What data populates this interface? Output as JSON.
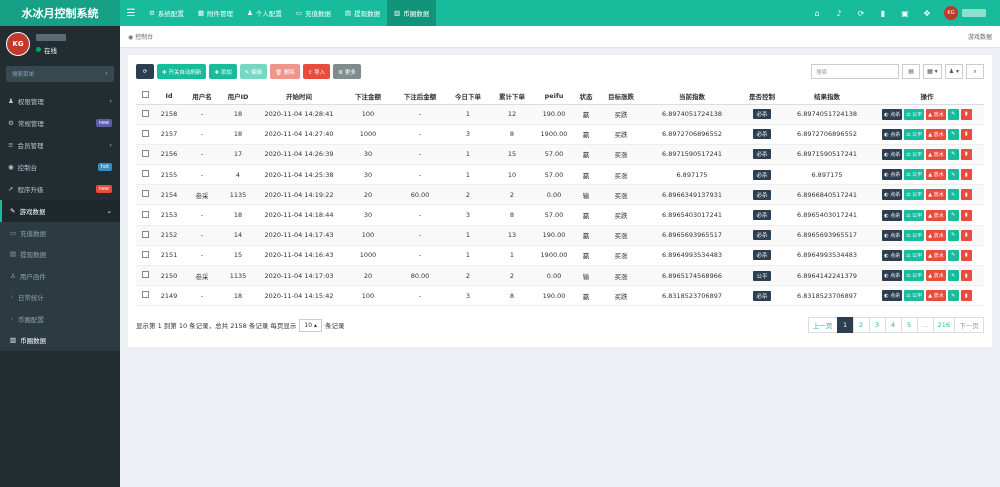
{
  "app": {
    "title": "水冰月控制系统"
  },
  "topnav": {
    "items": [
      {
        "icon": "gear-icon",
        "glyph": "⚙",
        "label": "系统配置"
      },
      {
        "icon": "paperclip-icon",
        "glyph": "▦",
        "label": "附件管理"
      },
      {
        "icon": "user-icon",
        "glyph": "♟",
        "label": "个人配置"
      },
      {
        "icon": "card-icon",
        "glyph": "▭",
        "label": "充值数据"
      },
      {
        "icon": "list-icon",
        "glyph": "▤",
        "label": "提现数据"
      },
      {
        "icon": "chart-icon",
        "glyph": "▥",
        "label": "币圈数据"
      }
    ],
    "avatar_text": "KG"
  },
  "user": {
    "avatar_text": "KG",
    "status": "在线"
  },
  "sidebar": {
    "search_placeholder": "搜索菜单",
    "items": [
      {
        "icon": "group-icon",
        "glyph": "♟",
        "label": "权限管理",
        "arrow": "‹"
      },
      {
        "icon": "cog-icon",
        "glyph": "⚙",
        "label": "常规管理",
        "badge": "new",
        "badge_color": "#605ca8"
      },
      {
        "icon": "list-icon",
        "glyph": "≡",
        "label": "会员管理",
        "arrow": "‹"
      },
      {
        "icon": "dashboard-icon",
        "glyph": "◉",
        "label": "控制台",
        "badge": "hot",
        "badge_color": "#3c8dbc"
      },
      {
        "icon": "rocket-icon",
        "glyph": "➚",
        "label": "程序升级",
        "badge": "new",
        "badge_color": "#e74c3c"
      },
      {
        "icon": "wrench-icon",
        "glyph": "✎",
        "label": "游戏数据",
        "arrow": "⌄"
      }
    ],
    "subitems": [
      {
        "icon": "card-icon",
        "glyph": "▭",
        "label": "充值数据"
      },
      {
        "icon": "list-icon",
        "glyph": "▤",
        "label": "提现数据"
      },
      {
        "icon": "user-icon",
        "glyph": "♙",
        "label": "用户函件"
      },
      {
        "icon": "circle-icon",
        "glyph": "◦",
        "label": "日常统计"
      },
      {
        "icon": "circle-icon",
        "glyph": "◦",
        "label": "币圈配置"
      },
      {
        "icon": "chart-icon",
        "glyph": "▥",
        "label": "币圈数据"
      }
    ]
  },
  "breadcrumb": {
    "home": "控制台",
    "current": "游戏数据"
  },
  "toolbar": {
    "refresh": "⟳",
    "switch": "✚ 开关自动刷新",
    "add": "✚ 添加",
    "edit": "✎ 编辑",
    "delete": "🗑 删除",
    "import": "⇪ 导入",
    "more": "⚙ 更多"
  },
  "search": {
    "placeholder": "搜索"
  },
  "table": {
    "columns": [
      "Id",
      "用户名",
      "用户ID",
      "开始时间",
      "下注金额",
      "下注后金额",
      "今日下单",
      "累计下单",
      "peifu",
      "状态",
      "目标涨跌",
      "当前指数",
      "是否控制",
      "结果指数",
      "操作"
    ],
    "rows": [
      [
        "2158",
        "-",
        "18",
        "2020-11-04 14:28:41",
        "100",
        "-",
        "1",
        "12",
        "190.00",
        "赢",
        "买跌",
        "6.8974051724138",
        "必杀",
        "6.8974051724138"
      ],
      [
        "2157",
        "-",
        "18",
        "2020-11-04 14:27:40",
        "1000",
        "-",
        "3",
        "8",
        "1900.00",
        "赢",
        "买跌",
        "6.8972706896552",
        "必杀",
        "6.8972706896552"
      ],
      [
        "2156",
        "-",
        "17",
        "2020-11-04 14:26:39",
        "30",
        "-",
        "1",
        "15",
        "57.00",
        "赢",
        "买涨",
        "6.8971590517241",
        "必杀",
        "6.8971590517241"
      ],
      [
        "2155",
        "-",
        "4",
        "2020-11-04 14:25:38",
        "30",
        "-",
        "1",
        "10",
        "57.00",
        "赢",
        "买涨",
        "6.897175",
        "必杀",
        "6.897175"
      ],
      [
        "2154",
        "叁采",
        "1135",
        "2020-11-04 14:19:22",
        "20",
        "60.00",
        "2",
        "2",
        "0.00",
        "输",
        "买涨",
        "6.8966349137931",
        "必杀",
        "6.8966840517241"
      ],
      [
        "2153",
        "-",
        "18",
        "2020-11-04 14:18:44",
        "30",
        "-",
        "3",
        "8",
        "57.00",
        "赢",
        "买跌",
        "6.8965403017241",
        "必杀",
        "6.8965403017241"
      ],
      [
        "2152",
        "-",
        "14",
        "2020-11-04 14:17:43",
        "100",
        "-",
        "1",
        "13",
        "190.00",
        "赢",
        "买涨",
        "6.8965693965517",
        "必杀",
        "6.8965693965517"
      ],
      [
        "2151",
        "-",
        "15",
        "2020-11-04 14:16:43",
        "1000",
        "-",
        "1",
        "1",
        "1900.00",
        "赢",
        "买涨",
        "6.8964993534483",
        "必杀",
        "6.8964993534483"
      ],
      [
        "2150",
        "叁采",
        "1135",
        "2020-11-04 14:17:03",
        "20",
        "80.00",
        "2",
        "2",
        "0.00",
        "输",
        "买涨",
        "6.8965174568966",
        "公平",
        "6.8964142241379"
      ],
      [
        "2149",
        "-",
        "18",
        "2020-11-04 14:15:42",
        "100",
        "-",
        "3",
        "8",
        "190.00",
        "赢",
        "买跌",
        "6.8318523706897",
        "必杀",
        "6.8318523706897"
      ]
    ],
    "actions": {
      "kill": "点杀",
      "fair": "公平",
      "release": "放水"
    }
  },
  "footer": {
    "summary": "显示第 1 到第 10 条记录，总共 2158 条记录 每页显示",
    "page_size": "10",
    "suffix": "条记录"
  },
  "pager": {
    "prev": "上一页",
    "pages": [
      "1",
      "2",
      "3",
      "4",
      "5",
      "...",
      "216"
    ],
    "next": "下一页"
  }
}
